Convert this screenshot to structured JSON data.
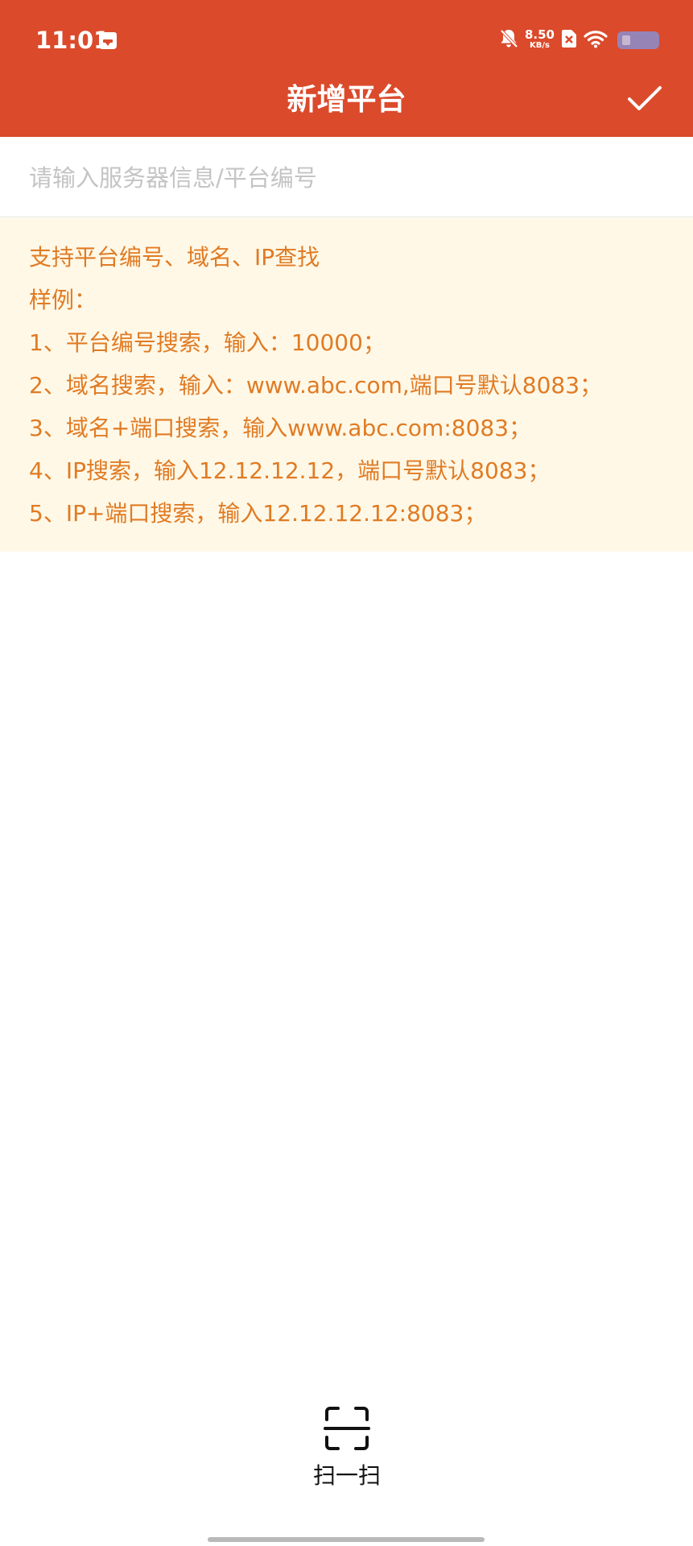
{
  "status_bar": {
    "time": "11:01",
    "net_speed_value": "8.50",
    "net_speed_unit": "KB/s",
    "icons": [
      "calendar-icon",
      "bell-off-icon",
      "sim-x-icon",
      "wifi-icon",
      "battery-icon"
    ]
  },
  "header": {
    "title": "新增平台",
    "confirm_icon": "check-icon"
  },
  "search": {
    "placeholder": "请输入服务器信息/平台编号",
    "value": ""
  },
  "hints": {
    "lines": [
      "支持平台编号、域名、IP查找",
      "样例：",
      "1、平台编号搜索，输入：10000；",
      "2、域名搜索，输入：www.abc.com,端口号默认8083；",
      "3、域名+端口搜索，输入www.abc.com:8083；",
      "4、IP搜索，输入12.12.12.12，端口号默认8083；",
      "5、IP+端口搜索，输入12.12.12.12:8083；"
    ]
  },
  "scan": {
    "label": "扫一扫",
    "icon": "scan-icon"
  },
  "colors": {
    "primary": "#db4a2b",
    "hint_background": "#fff8e7",
    "hint_text": "#e07b24",
    "placeholder": "#c4c4c4"
  }
}
